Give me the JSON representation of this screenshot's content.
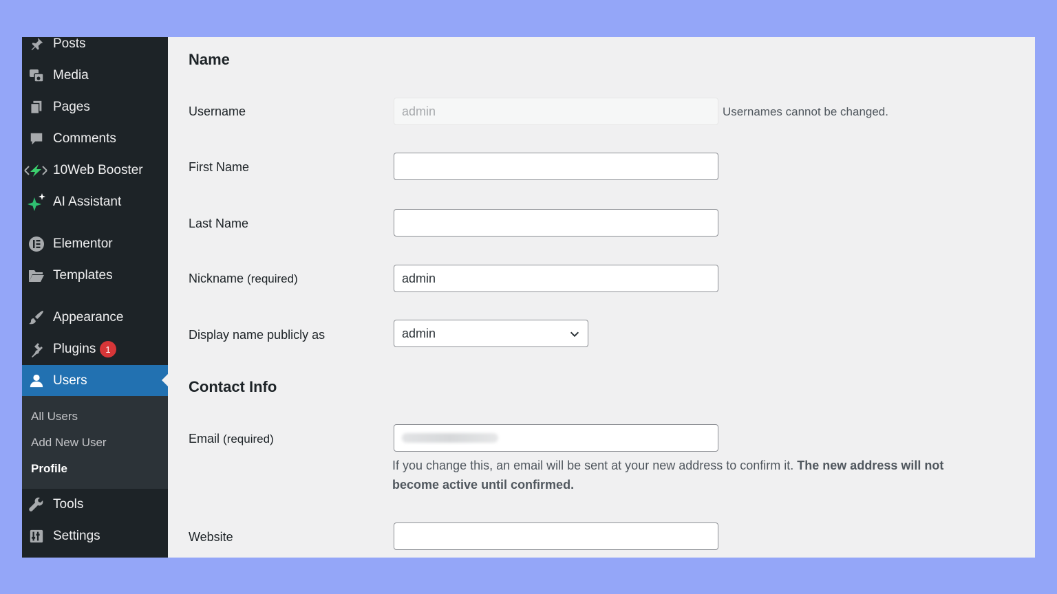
{
  "sidebar": {
    "items": [
      {
        "label": "Posts",
        "icon": "pushpin-icon"
      },
      {
        "label": "Media",
        "icon": "media-icon"
      },
      {
        "label": "Pages",
        "icon": "pages-icon"
      },
      {
        "label": "Comments",
        "icon": "comment-icon"
      },
      {
        "label": "10Web Booster",
        "icon": "booster-icon"
      },
      {
        "label": "AI Assistant",
        "icon": "sparkle-icon"
      },
      {
        "label": "Elementor",
        "icon": "elementor-icon"
      },
      {
        "label": "Templates",
        "icon": "folder-icon"
      },
      {
        "label": "Appearance",
        "icon": "paintbrush-icon"
      },
      {
        "label": "Plugins",
        "icon": "plug-icon",
        "badge": "1"
      },
      {
        "label": "Users",
        "icon": "user-icon"
      },
      {
        "label": "Tools",
        "icon": "wrench-icon"
      },
      {
        "label": "Settings",
        "icon": "settings-icon"
      }
    ],
    "submenu": [
      {
        "label": "All Users"
      },
      {
        "label": "Add New User"
      },
      {
        "label": "Profile"
      }
    ]
  },
  "form": {
    "name_section": "Name",
    "username_label": "Username",
    "username_value": "admin",
    "username_note": "Usernames cannot be changed.",
    "first_name_label": "First Name",
    "first_name_value": "",
    "last_name_label": "Last Name",
    "last_name_value": "",
    "nickname_label": "Nickname",
    "required": "(required)",
    "nickname_value": "admin",
    "display_name_label": "Display name publicly as",
    "display_name_value": "admin",
    "contact_section": "Contact Info",
    "email_label": "Email",
    "email_desc_line1_plain": "If you change this, an email will be sent at your new address to confirm it. ",
    "email_desc_line1_bold": "The new address will not",
    "email_desc_line2_bold": "become active until confirmed.",
    "website_label": "Website",
    "website_value": ""
  }
}
